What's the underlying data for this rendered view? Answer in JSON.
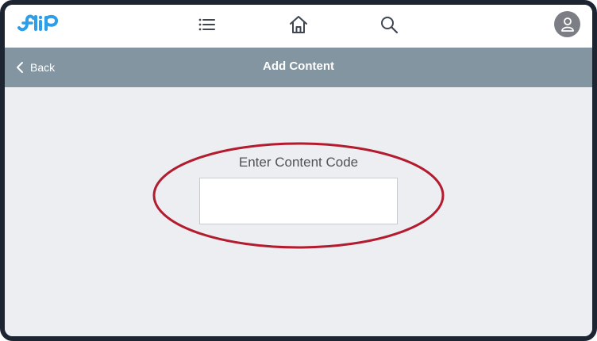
{
  "topbar": {
    "logo_text": "flip",
    "icons": [
      "menu-icon",
      "home-icon",
      "search-icon",
      "user-icon"
    ]
  },
  "subheader": {
    "back_label": "Back",
    "title": "Add Content"
  },
  "form": {
    "label": "Enter Content Code",
    "value": "",
    "placeholder": ""
  },
  "colors": {
    "frame": "#1e2532",
    "topbar": "#ffffff",
    "subheader": "#8495a2",
    "content_bg": "#eceef1",
    "logo": "#2f9ee9",
    "highlight": "#b31b2f"
  }
}
